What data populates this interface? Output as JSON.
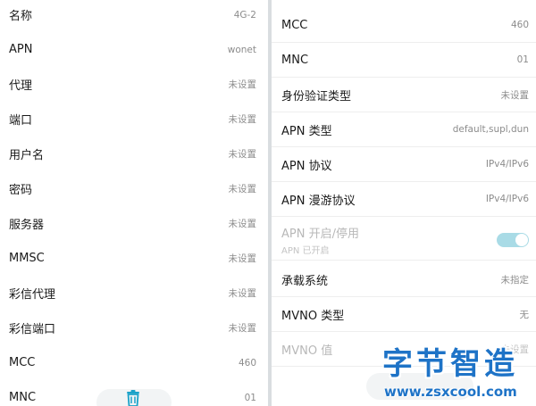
{
  "left_list": [
    {
      "label": "名称",
      "value": "4G-2"
    },
    {
      "label": "APN",
      "value": "wonet"
    },
    {
      "label": "代理",
      "value": "未设置"
    },
    {
      "label": "端口",
      "value": "未设置"
    },
    {
      "label": "用户名",
      "value": "未设置"
    },
    {
      "label": "密码",
      "value": "未设置"
    },
    {
      "label": "服务器",
      "value": "未设置"
    },
    {
      "label": "MMSC",
      "value": "未设置"
    },
    {
      "label": "彩信代理",
      "value": "未设置"
    },
    {
      "label": "彩信端口",
      "value": "未设置"
    },
    {
      "label": "MCC",
      "value": "460"
    },
    {
      "label": "MNC",
      "value": "01"
    }
  ],
  "right_list": [
    {
      "label": "MCC",
      "value": "460"
    },
    {
      "label": "MNC",
      "value": "01"
    },
    {
      "label": "身份验证类型",
      "value": "未设置"
    },
    {
      "label": "APN 类型",
      "value": "default,supl,dun"
    },
    {
      "label": "APN 协议",
      "value": "IPv4/IPv6"
    },
    {
      "label": "APN 漫游协议",
      "value": "IPv4/IPv6"
    },
    {
      "label": "APN 开启/停用",
      "sublabel": "APN 已开启",
      "toggle_on": true
    },
    {
      "label": "承载系统",
      "value": "未指定"
    },
    {
      "label": "MVNO 类型",
      "value": "无"
    },
    {
      "label": "MVNO 值",
      "value": "未设置"
    }
  ],
  "icons": {
    "delete": "trash-icon"
  },
  "colors": {
    "accent": "#1e73c7",
    "toggle": "#a9dbe6",
    "divider": "#d9dde0"
  },
  "watermark": {
    "title": "字节智造",
    "url": "www.zsxcool.com"
  }
}
